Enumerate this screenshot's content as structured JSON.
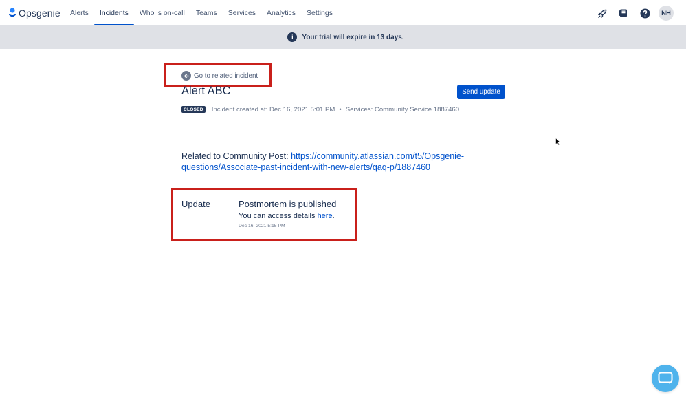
{
  "app": {
    "name": "Opsgenie"
  },
  "nav": {
    "items": [
      {
        "label": "Alerts",
        "active": false
      },
      {
        "label": "Incidents",
        "active": true
      },
      {
        "label": "Who is on-call",
        "active": false
      },
      {
        "label": "Teams",
        "active": false
      },
      {
        "label": "Services",
        "active": false
      },
      {
        "label": "Analytics",
        "active": false
      },
      {
        "label": "Settings",
        "active": false
      }
    ],
    "right_icons": [
      "rocket-icon",
      "book-icon",
      "help-icon"
    ],
    "avatar_initials": "NH"
  },
  "banner": {
    "icon": "info-icon",
    "text": "Your trial will expire in 13 days."
  },
  "incident": {
    "back_link_label": "Go to related incident",
    "title": "Alert ABC",
    "send_update_label": "Send update",
    "status_badge": "CLOSED",
    "created_text": "Incident created at: Dec 16, 2021 5:01 PM",
    "separator": "•",
    "services_text": "Services: Community Service 1887460",
    "related_prefix": "Related to Community Post: ",
    "related_link_line1": "https://community.atlassian.com/t5/Opsgenie-",
    "related_link_line2": "questions/Associate-past-incident-with-new-alerts/qaq-p/1887460"
  },
  "update": {
    "label": "Update",
    "title": "Postmortem is published",
    "body_prefix": "You can access details ",
    "body_link": "here",
    "body_suffix": ".",
    "date": "Dec 16, 2021 5:15 PM"
  },
  "colors": {
    "brand_blue": "#0052cc",
    "highlight_red": "#c9201b",
    "banner_bg": "#dfe1e6",
    "badge_bg": "#253858",
    "chat_bg": "#4fb3ec"
  }
}
